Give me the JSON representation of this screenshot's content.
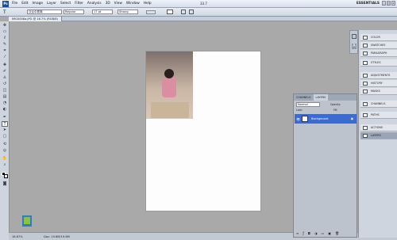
{
  "menubar": {
    "logo": "Ps",
    "items": [
      "File",
      "Edit",
      "Image",
      "Layer",
      "Select",
      "Filter",
      "Analysis",
      "3D",
      "View",
      "Window",
      "Help"
    ],
    "workspace": "ESSENTIALS",
    "zoom_level": "33.7"
  },
  "options": {
    "font_family": "汉仪中秀简",
    "font_style": "Regular",
    "font_size": "17 pt",
    "antialias": "Strong"
  },
  "document": {
    "tab_title": "IMG0008a.JPG @ 16.7% (RGB/8)"
  },
  "status": {
    "zoom": "16.67%",
    "doc_size": "Doc: 19.6M/19.6M"
  },
  "layers_panel": {
    "tabs": [
      "CHANNELS",
      "LAYERS"
    ],
    "mode": "Normal",
    "opacity_label": "Opacity:",
    "lock_label": "Lock:",
    "fill_label": "Fill:",
    "layer_name": "Background"
  },
  "dock": [
    {
      "label": "COLOR",
      "icon": "color-icon"
    },
    {
      "label": "SWATCHES",
      "icon": "swatches-icon"
    },
    {
      "label": "PARAGRAPH",
      "icon": "paragraph-icon"
    },
    {
      "label": "STYLES",
      "icon": "styles-icon"
    },
    {
      "label": "ADJUSTMENTS",
      "icon": "adjustments-icon"
    },
    {
      "label": "HISTORY",
      "icon": "history-icon"
    },
    {
      "label": "MASKS",
      "icon": "masks-icon"
    },
    {
      "label": "CHANNELS",
      "icon": "channels-icon"
    },
    {
      "label": "PATHS",
      "icon": "paths-icon"
    },
    {
      "label": "ACTIONS",
      "icon": "actions-icon"
    },
    {
      "label": "LAYERS",
      "icon": "layers-icon"
    }
  ]
}
